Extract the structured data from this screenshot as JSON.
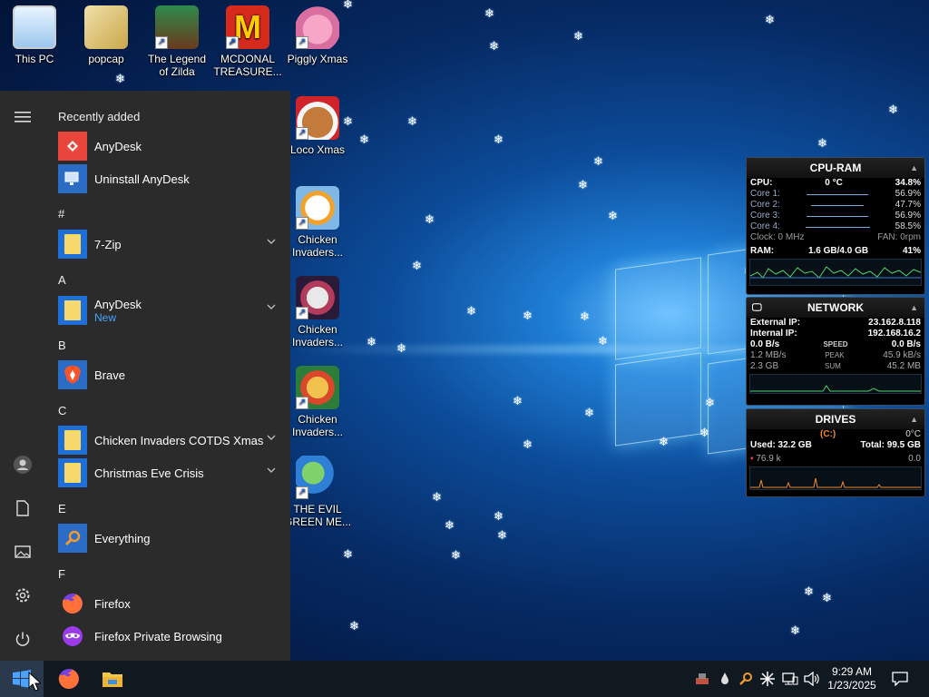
{
  "desktop": {
    "icons": [
      {
        "label": "This PC",
        "icon": "computer-icon"
      },
      {
        "label": "popcap",
        "icon": "folder-icon"
      },
      {
        "label": "The Legend of Zilda",
        "icon": "game-icon"
      },
      {
        "label": "MCDONAL TREASURE...",
        "icon": "mcdonalds-icon"
      },
      {
        "label": "Piggly Xmas",
        "icon": "pig-icon"
      },
      {
        "label": "Loco Xmas",
        "icon": "bear-icon"
      },
      {
        "label": "Chicken Invaders...",
        "icon": "chicken-icon"
      },
      {
        "label": "Chicken Invaders...",
        "icon": "chicken-icon"
      },
      {
        "label": "Chicken Invaders...",
        "icon": "chicken-icon"
      },
      {
        "label": "THE EVIL GREEN ME...",
        "icon": "game-icon"
      }
    ]
  },
  "start_menu": {
    "recently_added": "Recently added",
    "apps": [
      {
        "label": "AnyDesk",
        "color": "#e8453c"
      },
      {
        "label": "Uninstall AnyDesk"
      },
      {
        "section": "#"
      },
      {
        "label": "7-Zip"
      },
      {
        "section": "A"
      },
      {
        "label": "AnyDesk",
        "sub": "New"
      },
      {
        "section": "B"
      },
      {
        "label": "Brave",
        "color": "#fb542b"
      },
      {
        "section": "C"
      },
      {
        "label": "Chicken Invaders COTDS Xmas"
      },
      {
        "label": "Christmas Eve Crisis"
      },
      {
        "section": "E"
      },
      {
        "label": "Everything"
      },
      {
        "section": "F"
      },
      {
        "label": "Firefox"
      },
      {
        "label": "Firefox Private Browsing"
      }
    ]
  },
  "taskbar": {
    "time": "9:29 AM",
    "date": "1/23/2025"
  },
  "gadgets": {
    "cpu": {
      "title": "CPU-RAM",
      "cpu_label": "CPU:",
      "cpu_temp": "0 °C",
      "cpu_pct": "34.8%",
      "cores": [
        {
          "label": "Core 1:",
          "value": "56.9%",
          "fill": 0.57
        },
        {
          "label": "Core 2:",
          "value": "47.7%",
          "fill": 0.48
        },
        {
          "label": "Core 3:",
          "value": "56.9%",
          "fill": 0.57
        },
        {
          "label": "Core 4:",
          "value": "58.5%",
          "fill": 0.59
        }
      ],
      "clock": "Clock: 0 MHz",
      "fan": "FAN: 0rpm",
      "ram_label": "RAM:",
      "ram_value": "1.6 GB/4.0 GB",
      "ram_pct": "41%"
    },
    "network": {
      "title": "NETWORK",
      "external_label": "External IP:",
      "external_ip": "23.162.8.118",
      "internal_label": "Internal IP:",
      "internal_ip": "192.168.16.2",
      "speed_down": "0.0 B/s",
      "speed_label": "SPEED",
      "speed_up": "0.0 B/s",
      "peak_down": "1.2 MB/s",
      "peak_label": "PEAK",
      "peak_up": "45.9 kB/s",
      "sum_down": "2.3 GB",
      "sum_label": "SUM",
      "sum_up": "45.2 MB"
    },
    "drives": {
      "title": "DRIVES",
      "drive": "(C:)",
      "temp": "0°C",
      "used": "Used: 32.2 GB",
      "total": "Total: 99.5 GB",
      "read": "76.9 k",
      "write": "0.0"
    }
  }
}
